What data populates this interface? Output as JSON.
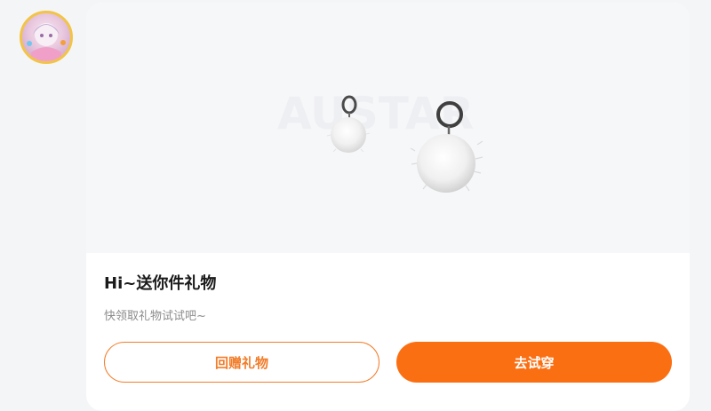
{
  "gift": {
    "title": "Hi~送你件礼物",
    "subtitle": "快领取礼物试试吧~",
    "product_image_alt": "earrings-product",
    "watermark_text": "AUSTAR"
  },
  "actions": {
    "return_gift_label": "回赠礼物",
    "try_on_label": "去试穿"
  },
  "colors": {
    "accent": "#fb6f13",
    "outline": "#f27d2a"
  },
  "icons": {
    "avatar": "user-avatar",
    "product": "pompom-earrings"
  }
}
